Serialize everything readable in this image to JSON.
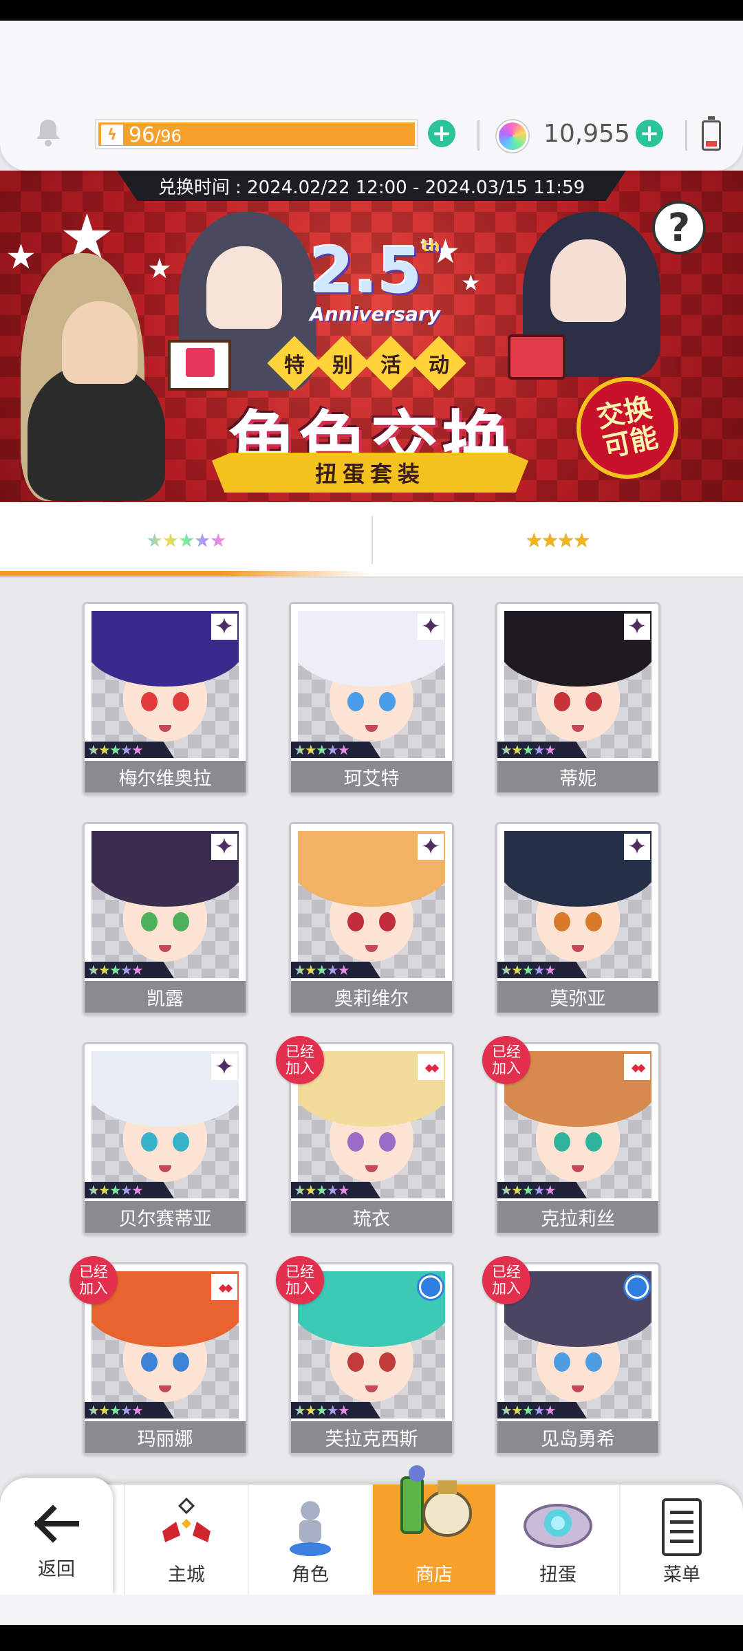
{
  "header": {
    "stamina_current": "96",
    "stamina_max": "96",
    "stamina_fill": 1.0,
    "gems": "10,955",
    "icons": [
      "bell-icon",
      "lightning-icon",
      "plus-icon",
      "gem-icon",
      "battery-icon"
    ]
  },
  "banner": {
    "exchange_time": "兑换时间 : 2024.02/22 12:00 - 2024.03/15 11:59",
    "anniversary_number": "2.5",
    "anniversary_suffix": "th",
    "anniversary_word": "Anniversary",
    "event_chars": [
      "特",
      "别",
      "活",
      "动"
    ],
    "title": "角色交换",
    "subtitle": "扭蛋套装",
    "badge": "交换可能",
    "help": "?"
  },
  "tabs": [
    {
      "label": "★★★★★",
      "active": true
    },
    {
      "label": "★★★★",
      "active": false
    }
  ],
  "characters": [
    {
      "name": "梅尔维奥拉",
      "rarity": "★★★★★",
      "element": "dark",
      "joined": false,
      "hair": "#3b2a8e",
      "eye": "#e23b3b"
    },
    {
      "name": "珂艾特",
      "rarity": "★★★★★",
      "element": "dark",
      "joined": false,
      "hair": "#eeeef6",
      "eye": "#4a9de8"
    },
    {
      "name": "蒂妮",
      "rarity": "★★★★★",
      "element": "dark",
      "joined": false,
      "hair": "#1f1a22",
      "eye": "#c7343a"
    },
    {
      "name": "凯露",
      "rarity": "★★★★★",
      "element": "dark",
      "joined": false,
      "hair": "#3a2d4f",
      "eye": "#4cb15a"
    },
    {
      "name": "奥莉维尔",
      "rarity": "★★★★★",
      "element": "dark",
      "joined": false,
      "hair": "#f2b266",
      "eye": "#c12d3b"
    },
    {
      "name": "莫弥亚",
      "rarity": "★★★★★",
      "element": "dark",
      "joined": false,
      "hair": "#233046",
      "eye": "#d97a2a"
    },
    {
      "name": "贝尔赛蒂亚",
      "rarity": "★★★★★",
      "element": "dark",
      "joined": false,
      "hair": "#e8eef4",
      "eye": "#37b3c9"
    },
    {
      "name": "琉衣",
      "rarity": "★★★★★",
      "element": "fire",
      "joined": true,
      "hair": "#f1dc9c",
      "eye": "#9a6bc7"
    },
    {
      "name": "克拉莉丝",
      "rarity": "★★★★★",
      "element": "fire",
      "joined": true,
      "hair": "#d68a4d",
      "eye": "#2fb49b"
    },
    {
      "name": "玛丽娜",
      "rarity": "★★★★★",
      "element": "fire",
      "joined": true,
      "hair": "#e8632f",
      "eye": "#3e84d6"
    },
    {
      "name": "芙拉克西斯",
      "rarity": "★★★★★",
      "element": "water",
      "joined": true,
      "hair": "#3cc9b6",
      "eye": "#c13b3b"
    },
    {
      "name": "见岛勇希",
      "rarity": "★★★★★",
      "element": "water",
      "joined": true,
      "hair": "#4a4560",
      "eye": "#4e9de0"
    }
  ],
  "joined_label": "已经加入",
  "nav": {
    "back": "返回",
    "items": [
      {
        "label": "主城",
        "icon": "castle-icon"
      },
      {
        "label": "角色",
        "icon": "character-icon"
      },
      {
        "label": "商店",
        "icon": "shop-icon",
        "active": true
      },
      {
        "label": "扭蛋",
        "icon": "gacha-icon"
      },
      {
        "label": "菜单",
        "icon": "menu-icon"
      }
    ]
  },
  "colors": {
    "accent_orange": "#f7a12d",
    "plus_green": "#2bc39a",
    "joined_red": "#e2304e",
    "banner_red": "#b81f25"
  }
}
